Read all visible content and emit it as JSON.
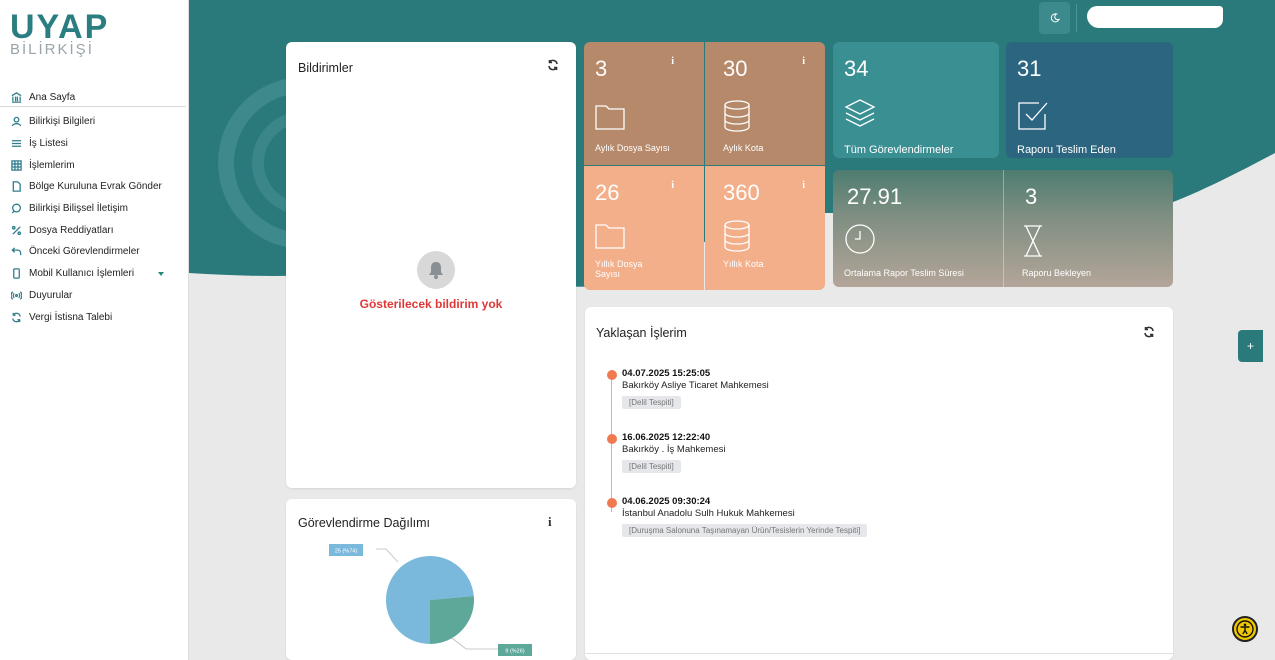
{
  "logo": {
    "title": "UYAP",
    "subtitle": "BİLİRKİŞİ"
  },
  "sidebar": {
    "items": [
      {
        "label": "Ana Sayfa",
        "icon": "bank-icon"
      },
      {
        "label": "Bilirkişi Bilgileri",
        "icon": "user-icon"
      },
      {
        "label": "İş Listesi",
        "icon": "list-icon"
      },
      {
        "label": "İşlemlerim",
        "icon": "grid-icon"
      },
      {
        "label": "Bölge Kuruluna Evrak Gönder",
        "icon": "file-icon"
      },
      {
        "label": "Bilirkişi Bilişsel İletişim",
        "icon": "chat-icon"
      },
      {
        "label": "Dosya Reddiyatları",
        "icon": "percent-icon"
      },
      {
        "label": "Önceki Görevlendirmeler",
        "icon": "undo-icon"
      },
      {
        "label": "Mobil Kullanıcı İşlemleri",
        "icon": "mobile-icon"
      },
      {
        "label": "Duyurular",
        "icon": "broadcast-icon"
      },
      {
        "label": "Vergi İstisna Talebi",
        "icon": "refresh-icon"
      }
    ]
  },
  "notifications": {
    "title": "Bildirimler",
    "empty_text": "Gösterilecek bildirim yok"
  },
  "stats": {
    "monthly_files": {
      "value": "3",
      "label": "Aylık Dosya Sayısı"
    },
    "monthly_quota": {
      "value": "30",
      "label": "Aylık Kota"
    },
    "yearly_files": {
      "value": "26",
      "label": "Yıllık Dosya Sayısı"
    },
    "yearly_quota": {
      "value": "360",
      "label": "Yıllık Kota"
    },
    "all_assignments": {
      "value": "34",
      "label": "Tüm Görevlendirmeler"
    },
    "reports_delivered": {
      "value": "31",
      "label": "Raporu Teslim Eden"
    },
    "avg_report_time": {
      "value": "27.91",
      "label": "Ortalama Rapor Teslim Süresi"
    },
    "reports_pending": {
      "value": "3",
      "label": "Raporu Bekleyen"
    },
    "info_glyph": "i"
  },
  "upcoming": {
    "title": "Yaklaşan İşlerim",
    "items": [
      {
        "date": "04.07.2025 15:25:05",
        "court": "Bakırköy    Asliye Ticaret Mahkemesi",
        "tag": "[Delil Tespiti]"
      },
      {
        "date": "16.06.2025 12:22:40",
        "court": "Bakırköy  . İş Mahkemesi",
        "tag": "[Delil Tespiti]"
      },
      {
        "date": "04.06.2025 09:30:24",
        "court": "İstanbul Anadolu     Sulh Hukuk Mahkemesi",
        "tag": "[Duruşma Salonuna Taşınamayan Ürün/Tesislerin Yerinde Tespiti]"
      }
    ]
  },
  "distribution": {
    "title": "Görevlendirme Dağılımı",
    "info_glyph": "i"
  },
  "chart_data": {
    "type": "pie",
    "title": "Görevlendirme Dağılımı",
    "categories": [
      "25 (%74)",
      "9 (%26)"
    ],
    "values": [
      25,
      9
    ],
    "colors": [
      "#7ab8dc",
      "#5ea89a"
    ]
  },
  "float_button": "+",
  "colors": {
    "teal": "#2a7a7c",
    "brown": "#b5896a",
    "peach": "#f3ae8a",
    "teal_tile": "#3a8f93",
    "navy_tile": "#2b6580",
    "red": "#e03838"
  }
}
